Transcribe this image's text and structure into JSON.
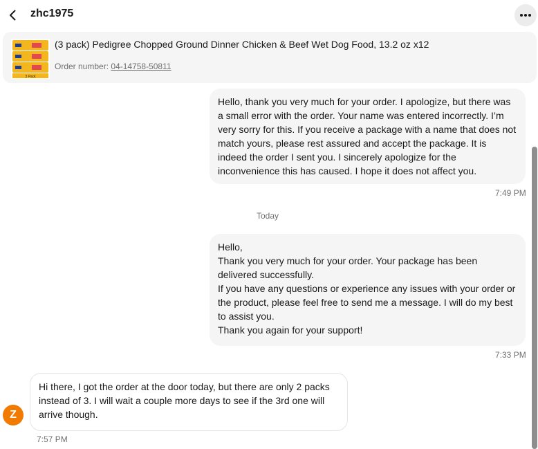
{
  "header": {
    "title": "zhc1975",
    "back_icon": "chevron-left-icon",
    "more_icon": "ellipsis-icon"
  },
  "order": {
    "title": "(3 pack) Pedigree Chopped Ground Dinner Chicken & Beef Wet Dog Food, 13.2 oz x12",
    "order_label": "Order number: ",
    "order_number": "04-14758-50811",
    "thumb_caption": "3 Pack"
  },
  "messages": [
    {
      "direction": "outgoing",
      "lines": [
        "Hello, thank you very much for your order. I apologize, but there was",
        "a small error with the order. Your name was entered incorrectly. I’m",
        "very sorry for this. If you receive a package with a name that does not",
        "match yours, please rest assured and accept the package. It is",
        "indeed the order I sent you. I sincerely apologize for the",
        "inconvenience this has caused. I hope it does not affect you."
      ],
      "time": "7:49 PM"
    },
    {
      "direction": "outgoing",
      "lines": [
        "Hello,",
        "Thank you very much for your order. Your package has been",
        "delivered successfully.",
        "If you have any questions or experience any issues with your order or",
        "the product, please feel free to send me a message. I will do my best",
        "to assist you.",
        "Thank you again for your support!"
      ],
      "time": "7:33 PM"
    },
    {
      "direction": "incoming",
      "lines": [
        "Hi there, I got the order at the door today, but there are only 2 packs",
        "instead of 3. I will wait a couple more days to see if the 3rd one will",
        "arrive though."
      ],
      "time": "7:57 PM"
    }
  ],
  "divider": {
    "label": "Today"
  },
  "avatar": {
    "initial": "Z",
    "color": "#f17a00"
  },
  "colors": {
    "bubble_outgoing": "#f5f5f5",
    "text": "#191919",
    "muted": "#707070"
  }
}
